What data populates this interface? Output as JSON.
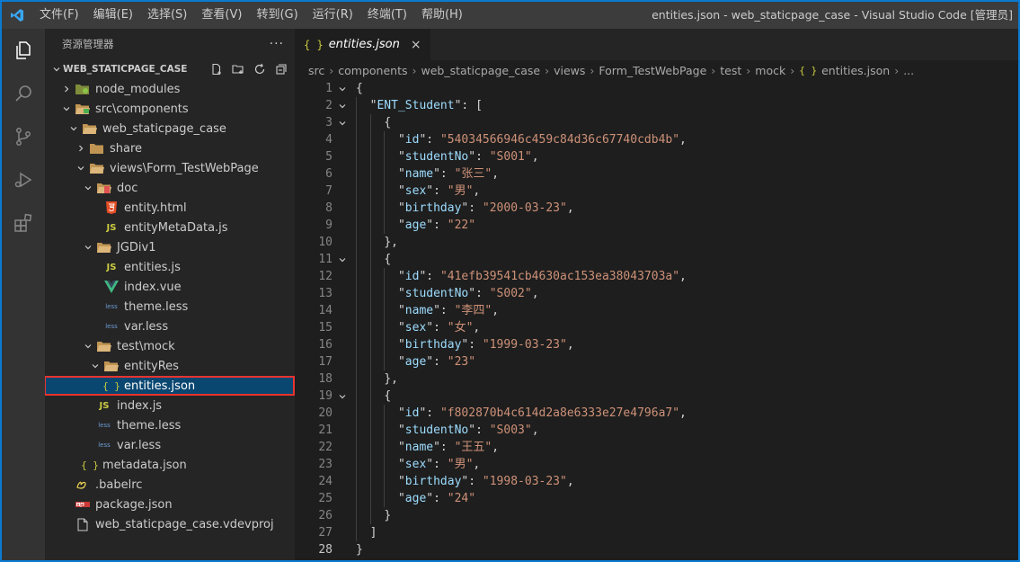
{
  "menu": [
    "文件(F)",
    "编辑(E)",
    "选择(S)",
    "查看(V)",
    "转到(G)",
    "运行(R)",
    "终端(T)",
    "帮助(H)"
  ],
  "window_title": "entities.json - web_staticpage_case - Visual Studio Code [管理员]",
  "sidebar": {
    "title": "资源管理器",
    "more": "···",
    "section_title": "WEB_STATICPAGE_CASE",
    "items": [
      {
        "label": "node_modules",
        "icon": "folder-node-icon"
      },
      {
        "label": "src\\components",
        "icon": "folder-src-icon"
      },
      {
        "label": "web_staticpage_case",
        "icon": "folder-icon"
      },
      {
        "label": "share",
        "icon": "folder-icon"
      },
      {
        "label": "views\\Form_TestWebPage",
        "icon": "folder-icon"
      },
      {
        "label": "doc",
        "icon": "folder-doc-icon"
      },
      {
        "label": "entity.html",
        "icon": "html-file-icon"
      },
      {
        "label": "entityMetaData.js",
        "icon": "js-file-icon"
      },
      {
        "label": "JGDiv1",
        "icon": "folder-icon"
      },
      {
        "label": "entities.js",
        "icon": "js-file-icon"
      },
      {
        "label": "index.vue",
        "icon": "vue-file-icon"
      },
      {
        "label": "theme.less",
        "icon": "less-file-icon"
      },
      {
        "label": "var.less",
        "icon": "less-file-icon"
      },
      {
        "label": "test\\mock",
        "icon": "folder-icon"
      },
      {
        "label": "entityRes",
        "icon": "folder-icon"
      },
      {
        "label": "entities.json",
        "icon": "json-file-icon"
      },
      {
        "label": "index.js",
        "icon": "js-file-icon"
      },
      {
        "label": "theme.less",
        "icon": "less-file-icon"
      },
      {
        "label": "var.less",
        "icon": "less-file-icon"
      },
      {
        "label": "metadata.json",
        "icon": "json-file-icon"
      },
      {
        "label": ".babelrc",
        "icon": "babel-file-icon"
      },
      {
        "label": "package.json",
        "icon": "npm-file-icon"
      },
      {
        "label": "web_staticpage_case.vdevproj",
        "icon": "file-icon"
      }
    ]
  },
  "icon_text": {
    "js": "JS",
    "json": "{ }",
    "less": "less"
  },
  "tab": {
    "icon": "{ }",
    "label": "entities.json",
    "close": "×"
  },
  "breadcrumb": {
    "parts": [
      "src",
      "components",
      "web_staticpage_case",
      "views",
      "Form_TestWebPage",
      "test",
      "mock"
    ],
    "file_icon": "{ }",
    "file": "entities.json",
    "tail": "..."
  },
  "code_lines": [
    {
      "n": "1",
      "t": "{"
    },
    {
      "n": "2",
      "t": "  \"ENT_Student\": ["
    },
    {
      "n": "3",
      "t": "    {"
    },
    {
      "n": "4",
      "t": "      \"id\": \"54034566946c459c84d36c67740cdb4b\","
    },
    {
      "n": "5",
      "t": "      \"studentNo\": \"S001\","
    },
    {
      "n": "6",
      "t": "      \"name\": \"张三\","
    },
    {
      "n": "7",
      "t": "      \"sex\": \"男\","
    },
    {
      "n": "8",
      "t": "      \"birthday\": \"2000-03-23\","
    },
    {
      "n": "9",
      "t": "      \"age\": \"22\""
    },
    {
      "n": "10",
      "t": "    },"
    },
    {
      "n": "11",
      "t": "    {"
    },
    {
      "n": "12",
      "t": "      \"id\": \"41efb39541cb4630ac153ea38043703a\","
    },
    {
      "n": "13",
      "t": "      \"studentNo\": \"S002\","
    },
    {
      "n": "14",
      "t": "      \"name\": \"李四\","
    },
    {
      "n": "15",
      "t": "      \"sex\": \"女\","
    },
    {
      "n": "16",
      "t": "      \"birthday\": \"1999-03-23\","
    },
    {
      "n": "17",
      "t": "      \"age\": \"23\""
    },
    {
      "n": "18",
      "t": "    },"
    },
    {
      "n": "19",
      "t": "    {"
    },
    {
      "n": "20",
      "t": "      \"id\": \"f802870b4c614d2a8e6333e27e4796a7\","
    },
    {
      "n": "21",
      "t": "      \"studentNo\": \"S003\","
    },
    {
      "n": "22",
      "t": "      \"name\": \"王五\","
    },
    {
      "n": "23",
      "t": "      \"sex\": \"男\","
    },
    {
      "n": "24",
      "t": "      \"birthday\": \"1998-03-23\","
    },
    {
      "n": "25",
      "t": "      \"age\": \"24\""
    },
    {
      "n": "26",
      "t": "    }"
    },
    {
      "n": "27",
      "t": "  ]"
    },
    {
      "n": "28",
      "t": "}"
    }
  ],
  "colors": {
    "key": "#9cdcfe",
    "string": "#ce9178",
    "punct": "#d4d4d4",
    "selection": "#094771",
    "highlight_box": "#e8332f"
  }
}
